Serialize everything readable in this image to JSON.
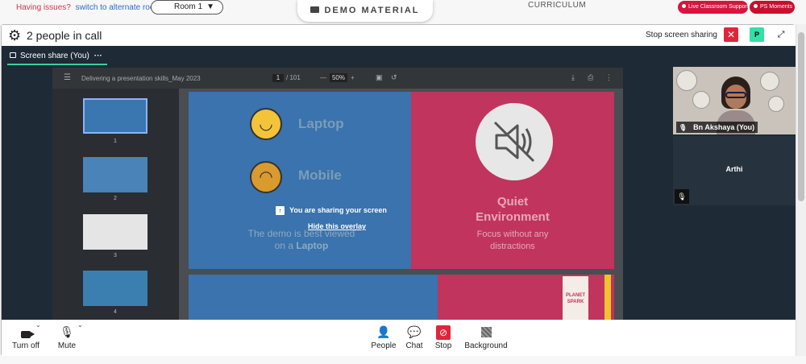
{
  "topbar": {
    "issues_text": "Having issues?",
    "alt_room_link": "switch to alternate room",
    "room_select": "Room 1",
    "demo_material": "DEMO MATERIAL",
    "curriculum": "CURRICULUM",
    "live_support": "Live Classroom Support",
    "ps_moments": "PS Moments"
  },
  "call": {
    "people_count": "2 people in call",
    "stop_screen_sharing": "Stop screen sharing",
    "p_badge": "P",
    "share_tab_label": "Screen share (You)"
  },
  "pdf": {
    "title": "Delivering a presentation skills_May 2023",
    "page_current": "1",
    "page_total": "/ 101",
    "zoom": "50%",
    "thumbnail_numbers": [
      "1",
      "2",
      "3",
      "4"
    ]
  },
  "slide": {
    "laptop": "Laptop",
    "mobile": "Mobile",
    "demo_note_line1": "The demo is best viewed",
    "demo_note_line2_prefix": "on a ",
    "demo_note_line2_bold": "Laptop",
    "quiet_line1": "Quiet",
    "quiet_line2": "Environment",
    "focus_line1": "Focus without any",
    "focus_line2": "distractions",
    "planet_spark_line1": "PLANET",
    "planet_spark_line2": "SPARK"
  },
  "overlay": {
    "sharing_message": "You are sharing your screen",
    "hide_link": "Hide this overlay"
  },
  "participants": {
    "self_name": "Bn Akshaya (You)",
    "other_name": "Arthi"
  },
  "controls": {
    "camera": "Turn off",
    "mic": "Mute",
    "people": "People",
    "chat": "Chat",
    "stop": "Stop",
    "background": "Background"
  },
  "colors": {
    "accent_red": "#e0253b",
    "accent_green": "#33e0a6",
    "stage_bg": "#1e2a36",
    "slide_blue": "#3a73ad",
    "slide_pink": "#c1345d"
  }
}
